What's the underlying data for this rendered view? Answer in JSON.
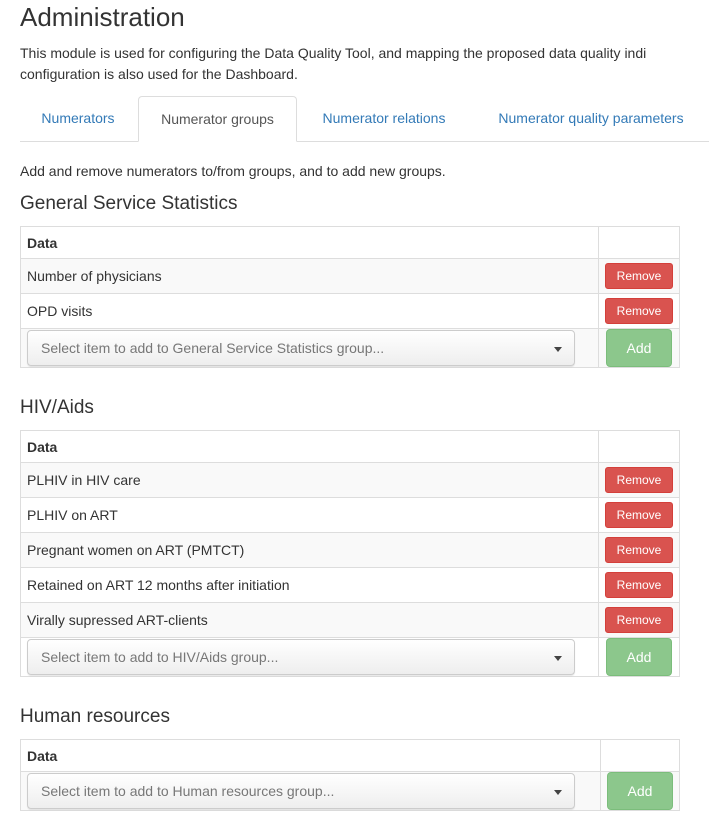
{
  "page": {
    "title": "Administration",
    "description_line1": "This module is used for configuring the Data Quality Tool, and mapping the proposed data quality indi",
    "description_line2": "configuration is also used for the Dashboard.",
    "intro": "Add and remove numerators to/from groups, and to add new groups."
  },
  "tabs": [
    {
      "label": "Numerators",
      "active": false
    },
    {
      "label": "Numerator groups",
      "active": true
    },
    {
      "label": "Numerator relations",
      "active": false
    },
    {
      "label": "Numerator quality parameters",
      "active": false
    }
  ],
  "table_header": "Data",
  "remove_label": "Remove",
  "add_label": "Add",
  "groups": [
    {
      "title": "General Service Statistics",
      "items": [
        "Number of physicians",
        "OPD visits"
      ],
      "select_placeholder": "Select item to add to General Service Statistics group..."
    },
    {
      "title": "HIV/Aids",
      "items": [
        "PLHIV in HIV care",
        "PLHIV on ART",
        "Pregnant women on ART (PMTCT)",
        "Retained on ART 12 months after initiation",
        "Virally supressed ART-clients"
      ],
      "select_placeholder": "Select item to add to HIV/Aids group..."
    },
    {
      "title": "Human resources",
      "items": [],
      "select_placeholder": "Select item to add to Human resources group..."
    }
  ],
  "colors": {
    "link": "#337ab7",
    "remove": "#d9534f",
    "add": "#8cc78c"
  }
}
